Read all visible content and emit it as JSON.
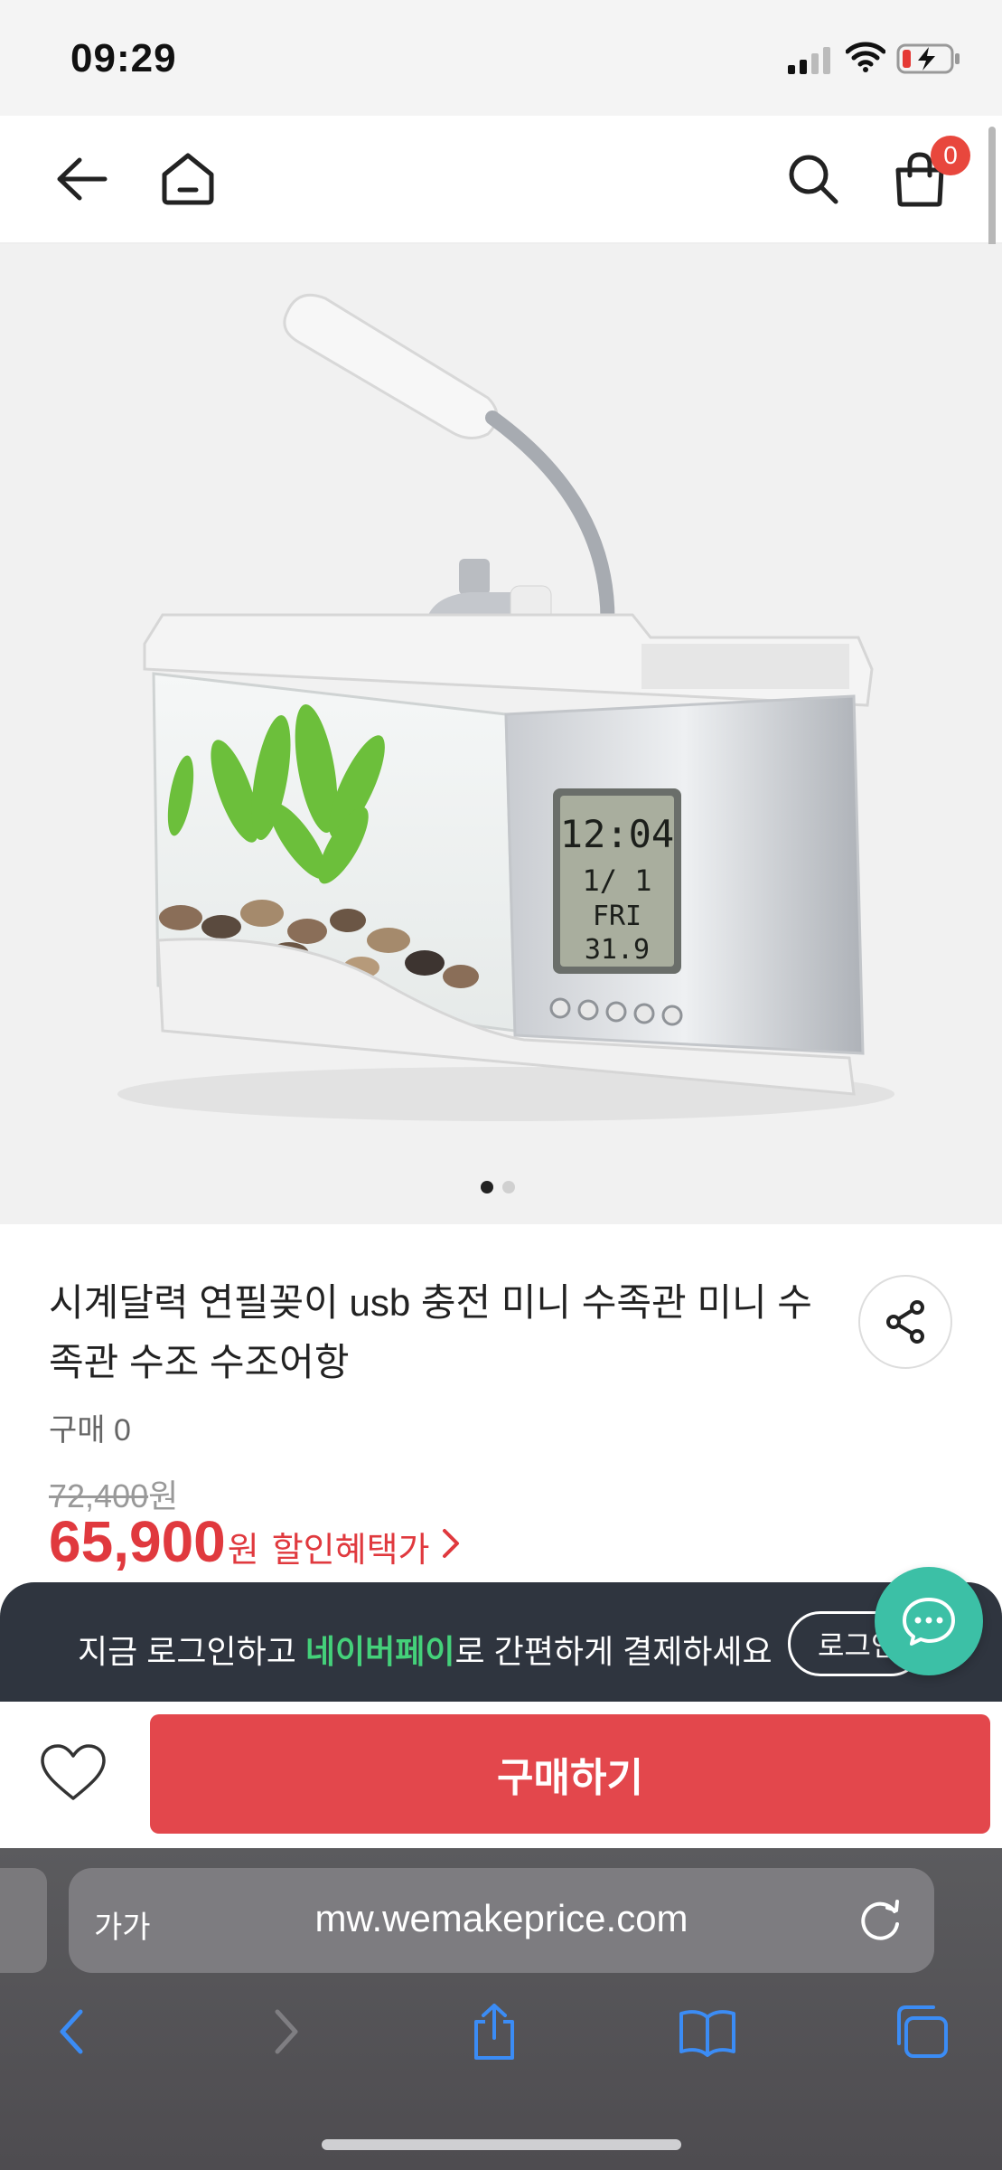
{
  "status_bar": {
    "time": "09:29"
  },
  "header": {
    "cart_count": "0"
  },
  "product": {
    "title": "시계달력 연필꽂이 usb 충전 미니 수족관 미니 수족관 수조 수조어항",
    "purchase_count": "구매 0",
    "original_price": "72,400",
    "original_price_unit": "원",
    "sale_price": "65,900",
    "sale_price_unit": "원",
    "discount_label": "할인혜택가",
    "lcd": {
      "time": "12:04",
      "date": "1/ 1",
      "day": "FRI",
      "temp": "31.9"
    },
    "image_dots": 2,
    "active_dot": 0
  },
  "banner": {
    "text_before": "지금 로그인하고 ",
    "highlight": "네이버페이",
    "text_after": "로 간편하게 결제하세요",
    "login_label": "로그인"
  },
  "buy_bar": {
    "buy_label": "구매하기"
  },
  "browser": {
    "aa_label": "가가",
    "url": "mw.wemakeprice.com"
  },
  "colors": {
    "accent_red": "#e3474c",
    "banner_bg": "#2f353f",
    "naverpay_green": "#44d17a",
    "chat_teal": "#3cc0a6"
  }
}
